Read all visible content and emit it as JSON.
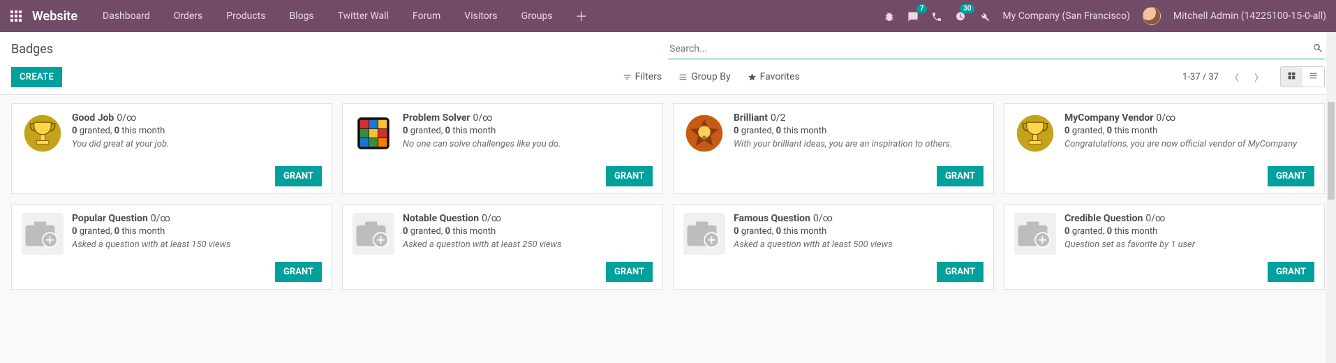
{
  "nav": {
    "brand": "Website",
    "items": [
      "Dashboard",
      "Orders",
      "Products",
      "Blogs",
      "Twitter Wall",
      "Forum",
      "Visitors",
      "Groups"
    ],
    "messaging_badge": "7",
    "activities_badge": "30",
    "company": "My Company (San Francisco)",
    "user": "Mitchell Admin (14225100-15-0-all)"
  },
  "cp": {
    "breadcrumb": "Badges",
    "search_placeholder": "Search...",
    "create": "CREATE",
    "filters": "Filters",
    "groupby": "Group By",
    "favorites": "Favorites",
    "pager": "1-37 / 37"
  },
  "grant_label": "GRANT",
  "badges": [
    {
      "title": "Good Job",
      "limit": "0/∞",
      "granted": "0",
      "month": "0",
      "desc": "You did great at your job.",
      "icon": "trophy"
    },
    {
      "title": "Problem Solver",
      "limit": "0/∞",
      "granted": "0",
      "month": "0",
      "desc": "No one can solve challenges like you do.",
      "icon": "cube"
    },
    {
      "title": "Brilliant",
      "limit": "0/2",
      "granted": "0",
      "month": "0",
      "desc": "With your brilliant ideas, you are an inspiration to others.",
      "icon": "star"
    },
    {
      "title": "MyCompany Vendor",
      "limit": "0/∞",
      "granted": "0",
      "month": "0",
      "desc": "Congratulations, you are now official vendor of MyCompany",
      "icon": "trophy"
    },
    {
      "title": "Popular Question",
      "limit": "0/∞",
      "granted": "0",
      "month": "0",
      "desc": "Asked a question with at least 150 views",
      "icon": "placeholder"
    },
    {
      "title": "Notable Question",
      "limit": "0/∞",
      "granted": "0",
      "month": "0",
      "desc": "Asked a question with at least 250 views",
      "icon": "placeholder"
    },
    {
      "title": "Famous Question",
      "limit": "0/∞",
      "granted": "0",
      "month": "0",
      "desc": "Asked a question with at least 500 views",
      "icon": "placeholder"
    },
    {
      "title": "Credible Question",
      "limit": "0/∞",
      "granted": "0",
      "month": "0",
      "desc": "Question set as favorite by 1 user",
      "icon": "placeholder"
    }
  ],
  "stats_tpl": {
    "granted_suffix": " granted, ",
    "month_suffix": " this month"
  }
}
